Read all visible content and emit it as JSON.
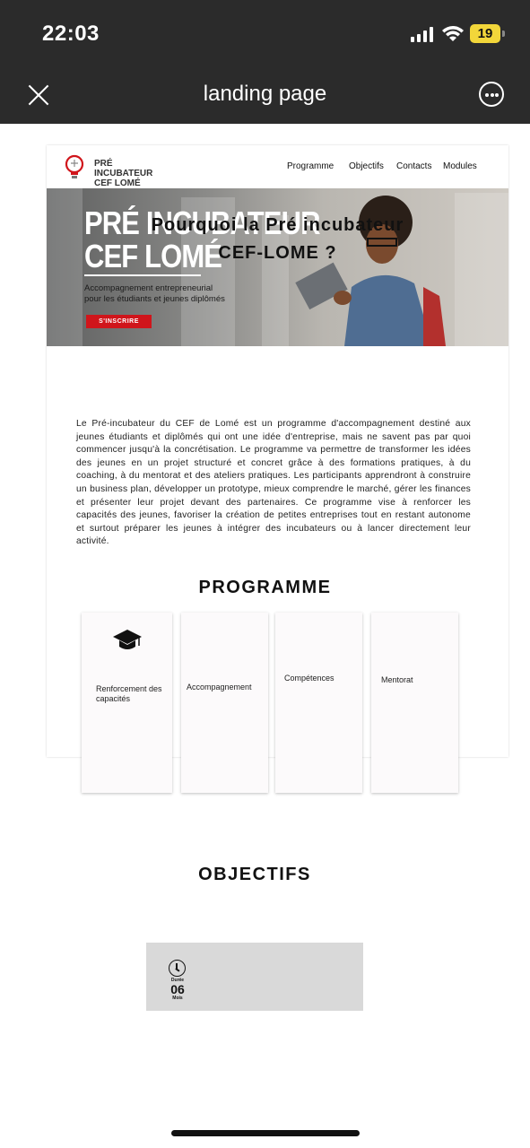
{
  "status_bar": {
    "time": "22:03",
    "battery": "19"
  },
  "nav": {
    "title": "landing page",
    "close_icon": "close-icon",
    "more_icon": "more-options-icon"
  },
  "site": {
    "logo_line1": "PRÉ INCUBATEUR",
    "logo_line2": "CEF LOMÉ",
    "menu": [
      "Programme",
      "Objectifs",
      "Contacts",
      "Modules"
    ]
  },
  "hero": {
    "title_line1": "PRÉ INCUBATEUR",
    "title_line2": "CEF LOMÉ",
    "subtitle_line1": "Accompagnement entrepreneurial",
    "subtitle_line2": "pour les étudiants et jeunes diplômés",
    "cta": "S'INSCRIRE"
  },
  "why": {
    "title_line1": "Pourquoi la Pré incubateur",
    "title_line2": "CEF-LOME ?",
    "paragraph": "Le Pré-incubateur du CEF de Lomé est un programme d'accompagnement destiné aux jeunes étudiants et diplômés qui ont une idée d'entreprise, mais ne savent pas par quoi commencer jusqu'à la concrétisation. Le programme va permettre de transformer les idées des jeunes en un projet structuré et concret grâce à des formations pratiques, à du coaching, à du mentorat et des ateliers pratiques. Les participants apprendront à construire un business plan, développer un prototype, mieux comprendre le marché, gérer les finances et présenter leur projet devant des partenaires. Ce programme vise à renforcer les capacités des jeunes, favoriser la création de petites entreprises tout en restant autonome et surtout préparer les jeunes à intégrer des incubateurs ou à lancer directement leur activité."
  },
  "programme": {
    "title": "PROGRAMME",
    "cards": [
      {
        "label": "Renforcement des capacités",
        "icon": "graduation-cap-icon"
      },
      {
        "label": "Accompagnement"
      },
      {
        "label": "Compétences"
      },
      {
        "label": "Mentorat"
      }
    ]
  },
  "objectifs": {
    "title": "OBJECTIFS",
    "duration_label": "Durée",
    "duration_value": "06",
    "duration_unit": "Mois",
    "icon": "clock-icon"
  },
  "colors": {
    "cta_red": "#d0151b",
    "bar_dark": "#2b2b2b",
    "battery_yellow": "#f2d63a"
  }
}
